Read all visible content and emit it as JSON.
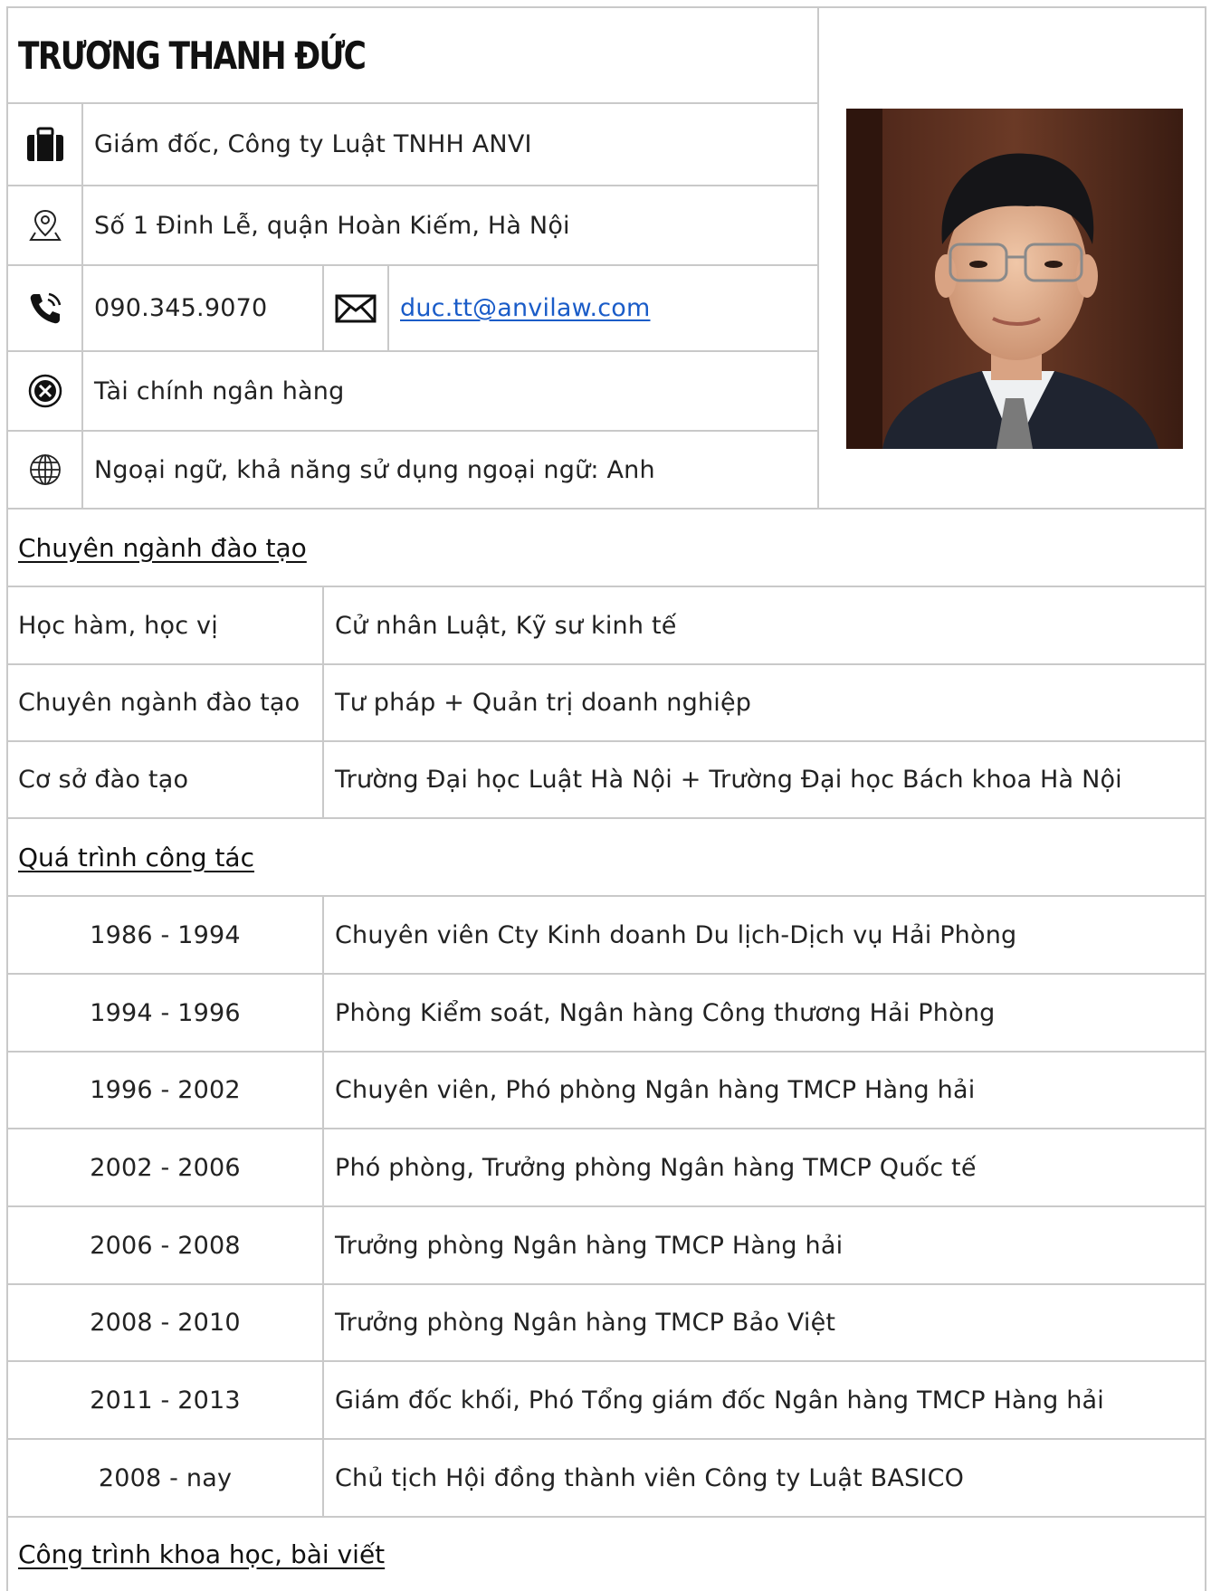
{
  "header": {
    "name": "TRƯƠNG THANH ĐỨC"
  },
  "contact": {
    "position": "Giám đốc, Công ty Luật TNHH ANVI",
    "address": "Số 1 Đinh Lễ, quận Hoàn Kiếm, Hà Nội",
    "phone": "090.345.9070",
    "email": "duc.tt@anvilaw.com",
    "field": "Tài chính ngân hàng",
    "languages": "Ngoại ngữ, khả năng sử dụng ngoại ngữ: Anh"
  },
  "icons": {
    "position": "briefcase-icon",
    "address": "map-pin-icon",
    "phone": "phone-icon",
    "email": "envelope-icon",
    "field": "specialty-icon",
    "languages": "globe-icon"
  },
  "education": {
    "heading": "Chuyên ngành đào tạo",
    "rows": [
      {
        "label": "Học hàm, học vị",
        "value": "Cử nhân Luật, Kỹ sư kinh tế"
      },
      {
        "label": "Chuyên ngành đào tạo",
        "value": "Tư pháp + Quản trị doanh nghiệp"
      },
      {
        "label": "Cơ sở đào tạo",
        "value": "Trường Đại học Luật Hà Nội + Trường Đại học Bách khoa Hà Nội"
      }
    ]
  },
  "career": {
    "heading": "Quá trình công tác",
    "rows": [
      {
        "years": "1986 - 1994",
        "desc": "Chuyên viên Cty Kinh doanh Du lịch-Dịch vụ Hải Phòng"
      },
      {
        "years": "1994 - 1996",
        "desc": "Phòng Kiểm soát, Ngân hàng Công thương Hải Phòng"
      },
      {
        "years": "1996 - 2002",
        "desc": "Chuyên viên, Phó phòng Ngân hàng TMCP Hàng hải"
      },
      {
        "years": "2002 - 2006",
        "desc": "Phó phòng, Trưởng phòng Ngân hàng TMCP Quốc tế"
      },
      {
        "years": "2006 - 2008",
        "desc": "Trưởng phòng Ngân hàng TMCP Hàng hải"
      },
      {
        "years": "2008 - 2010",
        "desc": "Trưởng phòng Ngân hàng TMCP Bảo Việt"
      },
      {
        "years": "2011 - 2013",
        "desc": "Giám đốc khối, Phó Tổng giám đốc Ngân hàng TMCP Hàng hải"
      },
      {
        "years": "2008 - nay",
        "desc": "Chủ tịch Hội đồng thành viên Công ty Luật BASICO"
      }
    ]
  },
  "publications": {
    "heading": "Công trình khoa học, bài viết"
  },
  "colors": {
    "border": "#c9c9c9",
    "link": "#1a5cc8",
    "text": "#222222"
  }
}
